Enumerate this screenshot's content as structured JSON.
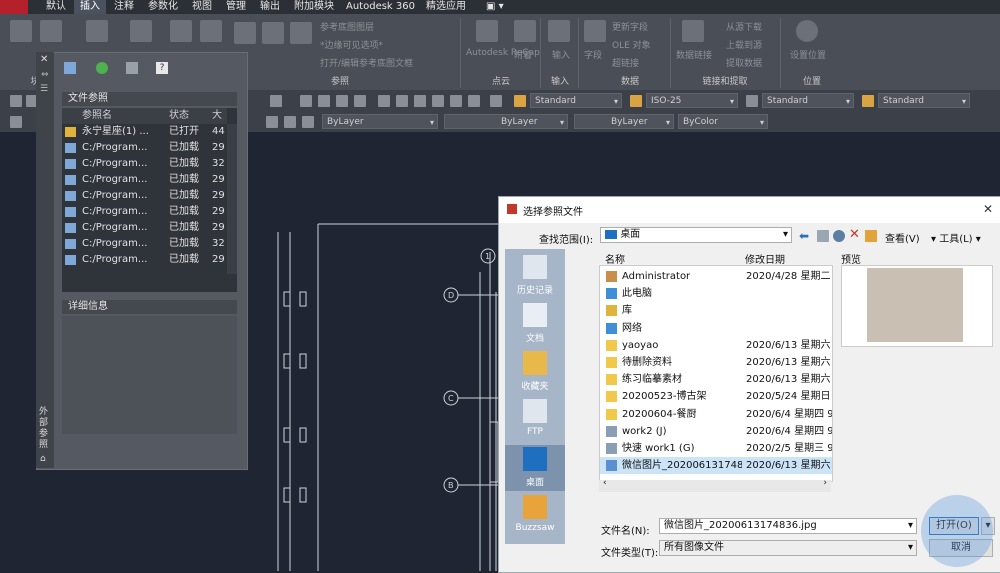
{
  "menubar": {
    "items": [
      "默认",
      "插入",
      "注释",
      "参数化",
      "视图",
      "管理",
      "输出",
      "附加模块",
      "Autodesk 360",
      "精选应用"
    ],
    "active_index": 1
  },
  "ribbon": {
    "panels": [
      "块",
      "参照",
      "点云",
      "输入",
      "数据",
      "链接和提取",
      "位置"
    ],
    "ghost_texts": [
      "参考底图图层",
      "*边缘可见选项*",
      "打开/编辑参考底图文框",
      "Autodesk ReCap",
      "附着",
      "输入",
      "字段",
      "更新字段",
      "OLE 对象",
      "超链接",
      "数据链接",
      "从源下载",
      "上载到源",
      "提取数据",
      "设置位置"
    ]
  },
  "toolbar": {
    "text_style": "Standard",
    "dim_style": "ISO-25",
    "table_style": "Standard",
    "mleader_style": "Standard",
    "layer": "ByLayer",
    "linetype": "ByLayer",
    "lineweight": "ByLayer",
    "color": "ByColor"
  },
  "xref_panel": {
    "section_title": "文件参照",
    "columns": [
      "参照名",
      "状态",
      "大"
    ],
    "rows": [
      {
        "name": "永宁星座(1) ...",
        "status": "已打开",
        "size": "44"
      },
      {
        "name": "C:/Program...",
        "status": "已加载",
        "size": "29"
      },
      {
        "name": "C:/Program...",
        "status": "已加载",
        "size": "32"
      },
      {
        "name": "C:/Program...",
        "status": "已加载",
        "size": "29"
      },
      {
        "name": "C:/Program...",
        "status": "已加载",
        "size": "29"
      },
      {
        "name": "C:/Program...",
        "status": "已加载",
        "size": "29"
      },
      {
        "name": "C:/Program...",
        "status": "已加载",
        "size": "29"
      },
      {
        "name": "C:/Program...",
        "status": "已加载",
        "size": "32"
      },
      {
        "name": "C:/Program...",
        "status": "已加载",
        "size": "29"
      }
    ],
    "details_title": "详细信息",
    "vertical_label": "外部参照"
  },
  "dialog": {
    "title": "选择参照文件",
    "lookin_label": "查找范围(I):",
    "lookin_value": "桌面",
    "view_label": "查看(V)",
    "tools_label": "工具(L)",
    "col_name": "名称",
    "col_date": "修改日期",
    "preview_label": "预览",
    "places": [
      "历史记录",
      "文档",
      "收藏夹",
      "FTP",
      "桌面",
      "Buzzsaw"
    ],
    "files": [
      {
        "name": "Administrator",
        "date": "2020/4/28 星期二 2.",
        "icon": "user-icon"
      },
      {
        "name": "此电脑",
        "date": "",
        "icon": "computer-icon"
      },
      {
        "name": "库",
        "date": "",
        "icon": "library-icon"
      },
      {
        "name": "网络",
        "date": "",
        "icon": "network-icon"
      },
      {
        "name": "yaoyao",
        "date": "2020/6/13 星期六 8.",
        "icon": "folder-icon"
      },
      {
        "name": "待删除资料",
        "date": "2020/6/13 星期六 1.",
        "icon": "folder-icon"
      },
      {
        "name": "练习临摹素材",
        "date": "2020/6/13 星期六 8.",
        "icon": "folder-icon"
      },
      {
        "name": "20200523-博古架",
        "date": "2020/5/24 星期日 9.",
        "icon": "folder-icon"
      },
      {
        "name": "20200604-餐厨",
        "date": "2020/6/4 星期四 9:3",
        "icon": "folder-icon"
      },
      {
        "name": "work2 (J)",
        "date": "2020/6/4 星期四 9:3",
        "icon": "shortcut-icon"
      },
      {
        "name": "快速 work1 (G)",
        "date": "2020/2/5 星期三 9:5",
        "icon": "shortcut-icon"
      },
      {
        "name": "微信图片_2020061317483...",
        "date": "2020/6/13 星期六 1.",
        "icon": "image-icon"
      }
    ],
    "selected_index": 11,
    "filename_label": "文件名(N):",
    "filename_value": "微信图片_20200613174836.jpg",
    "filetype_label": "文件类型(T):",
    "filetype_value": "所有图像文件",
    "open_label": "打开(O)",
    "cancel_label": "取消"
  },
  "colors": {
    "accent": "#1f6fc1",
    "drawing_bg": "#1f2533",
    "selection": "#cce4f7"
  }
}
